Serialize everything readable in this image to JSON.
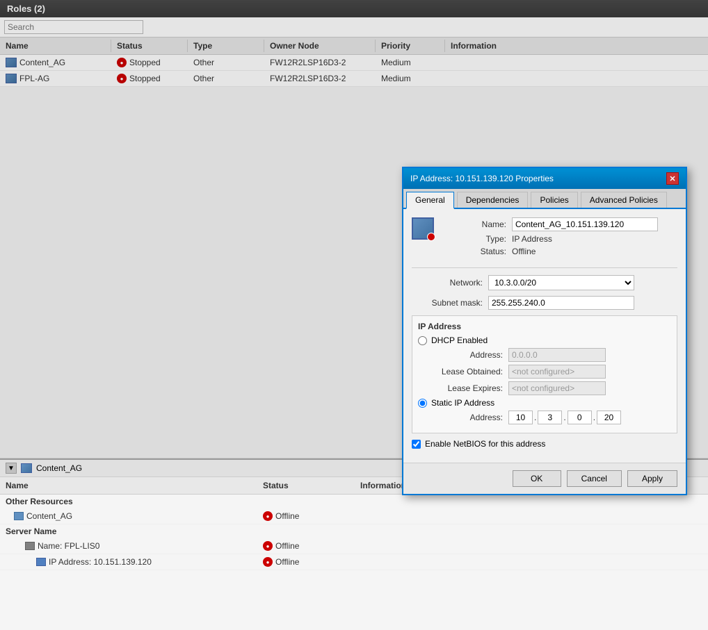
{
  "top_panel": {
    "title": "Roles (2)",
    "search_placeholder": "Search",
    "columns": [
      "Name",
      "Status",
      "Type",
      "Owner Node",
      "Priority",
      "Information"
    ],
    "rows": [
      {
        "name": "Content_AG",
        "status": "Stopped",
        "type": "Other",
        "owner_node": "FW12R2LSP16D3-2",
        "priority": "Medium",
        "information": ""
      },
      {
        "name": "FPL-AG",
        "status": "Stopped",
        "type": "Other",
        "owner_node": "FW12R2LSP16D3-2",
        "priority": "Medium",
        "information": ""
      }
    ]
  },
  "bottom_panel": {
    "title": "Content_AG",
    "columns": [
      "Name",
      "Status",
      "Information"
    ],
    "section_other": "Other Resources",
    "section_server": "Server Name",
    "rows_other": [
      {
        "name": "Content_AG",
        "status": "Offline",
        "information": ""
      }
    ],
    "rows_server": [
      {
        "name": "Name: FPL-LIS0",
        "status": "Offline",
        "information": "",
        "level": 1
      },
      {
        "name": "IP Address: 10.151.139.120",
        "status": "Offline",
        "information": "",
        "level": 2
      }
    ]
  },
  "dialog": {
    "title": "IP Address: 10.151.139.120 Properties",
    "tabs": [
      "General",
      "Dependencies",
      "Policies",
      "Advanced Policies"
    ],
    "active_tab": "General",
    "close_label": "✕",
    "name_label": "Name:",
    "name_value": "Content_AG_10.151.139.120",
    "type_label": "Type:",
    "type_value": "IP Address",
    "status_label": "Status:",
    "status_value": "Offline",
    "network_label": "Network:",
    "network_value": "10.3.0.0/20",
    "subnet_label": "Subnet mask:",
    "subnet_value": "255.255.240.0",
    "ip_address_section": "IP Address",
    "dhcp_label": "DHCP Enabled",
    "address_label": "Address:",
    "address_value": "0.0.0.0",
    "lease_obtained_label": "Lease Obtained:",
    "lease_obtained_value": "<not configured>",
    "lease_expires_label": "Lease Expires:",
    "lease_expires_value": "<not configured>",
    "static_label": "Static IP Address",
    "static_address_label": "Address:",
    "static_ip": {
      "p1": "10",
      "p2": "3",
      "p3": "0",
      "p4": "20"
    },
    "netbios_label": "Enable NetBIOS for this address",
    "btn_ok": "OK",
    "btn_cancel": "Cancel",
    "btn_apply": "Apply"
  }
}
